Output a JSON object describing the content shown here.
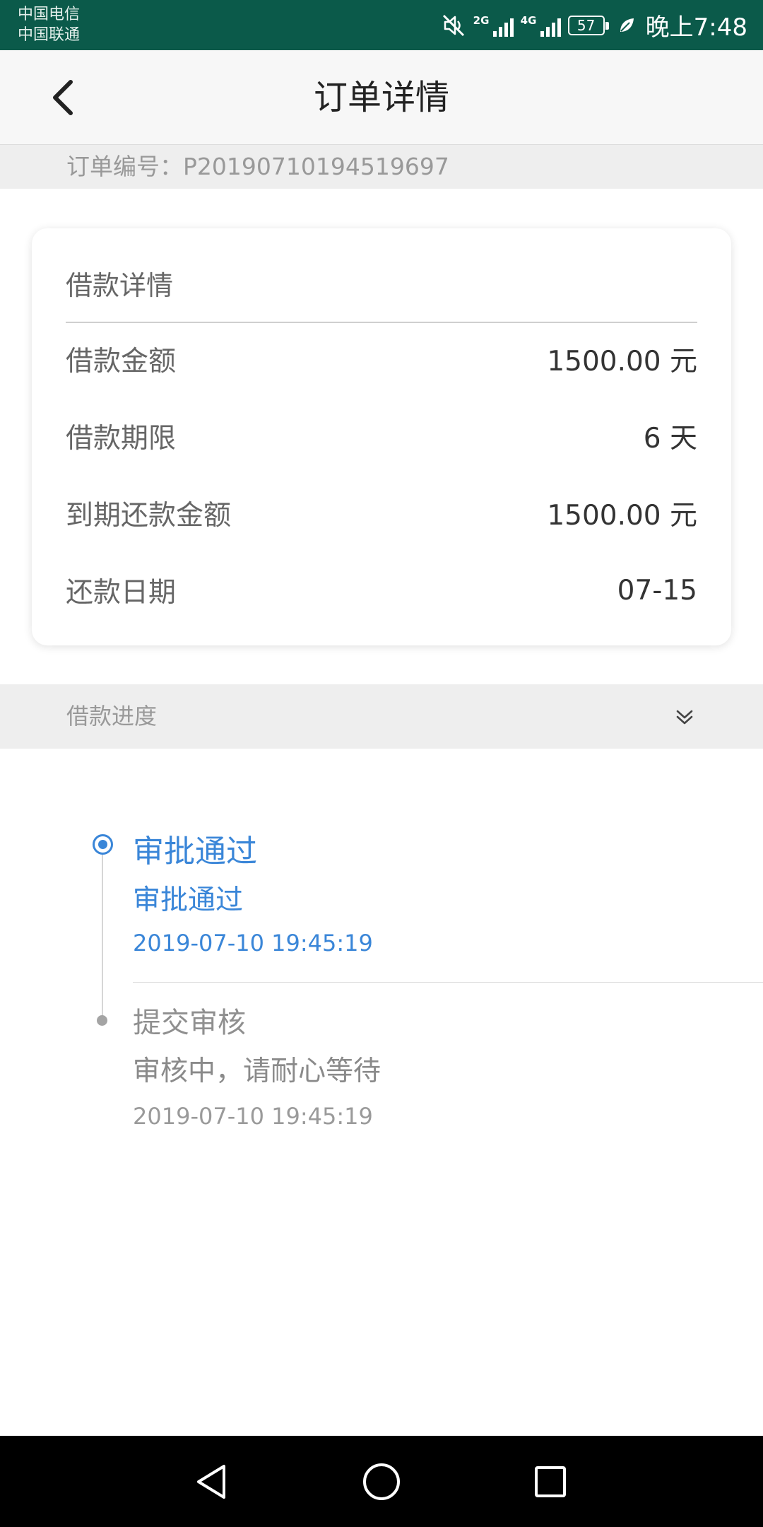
{
  "status_bar": {
    "carrier_1": "中国电信",
    "carrier_2": "中国联通",
    "network_1": "2G",
    "network_2": "4G",
    "battery_level": "57",
    "time": "晚上7:48",
    "icons": [
      "mute-icon",
      "signal-icon",
      "signal-icon",
      "battery-icon",
      "leaf-icon"
    ]
  },
  "header": {
    "title": "订单详情",
    "back_icon": "chevron-left-icon"
  },
  "order": {
    "number_label": "订单编号：P20190710194519697"
  },
  "loan_details": {
    "header": "借款详情",
    "rows": [
      {
        "label": "借款金额",
        "value": "1500.00 元"
      },
      {
        "label": "借款期限",
        "value": "6 天"
      },
      {
        "label": "到期还款金额",
        "value": "1500.00 元"
      },
      {
        "label": "还款日期",
        "value": "07-15"
      }
    ]
  },
  "progress": {
    "label": "借款进度",
    "toggle_icon": "double-chevron-down-icon",
    "steps": [
      {
        "title": "审批通过",
        "desc": "审批通过",
        "time": "2019-07-10 19:45:19",
        "status": "active"
      },
      {
        "title": "提交审核",
        "desc": "审核中，请耐心等待",
        "time": "2019-07-10 19:45:19",
        "status": "done"
      }
    ]
  },
  "nav_bar": {
    "buttons": [
      "back-triangle-icon",
      "home-circle-icon",
      "recents-square-icon"
    ]
  },
  "colors": {
    "status_bar": "#0b5a4a",
    "accent_blue": "#3a86d8",
    "muted_text": "#999999"
  }
}
